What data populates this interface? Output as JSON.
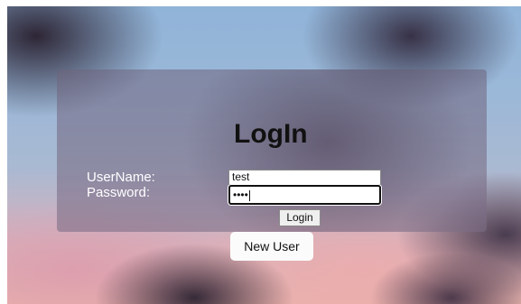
{
  "login": {
    "title": "LogIn",
    "username_label": "UserName:",
    "password_label": "Password:",
    "username_value": "test",
    "password_masked": "••••",
    "login_button": "Login",
    "new_user_button": "New User"
  },
  "colors": {
    "panel": "#6e6480",
    "title": "#111111",
    "label": "#ffffff"
  }
}
